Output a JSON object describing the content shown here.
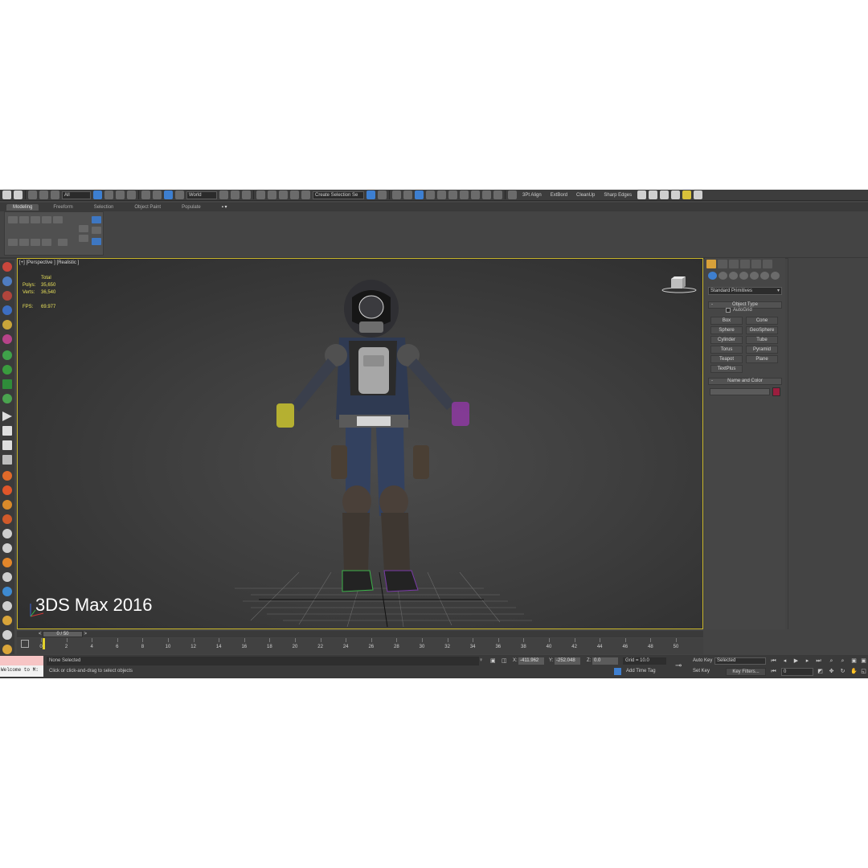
{
  "toolbar": {
    "selection_filter": "All",
    "reference_coord": "World",
    "named_selection": "Create Selection Se",
    "menu_items": [
      "3Pt Align",
      "ExtBord",
      "CleanUp",
      "Sharp Edges"
    ]
  },
  "ribbon": {
    "tabs": [
      "Modeling",
      "Freeform",
      "Selection",
      "Object Paint",
      "Populate"
    ],
    "active_tab": "Modeling"
  },
  "viewport": {
    "label": "[+] [Perspective ] [Realistic ]",
    "stats": {
      "header": "Total",
      "polys_label": "Polys:",
      "polys_value": "35,650",
      "verts_label": "Verts:",
      "verts_value": "36,540",
      "fps_label": "FPS:",
      "fps_value": "69.977"
    },
    "watermark": "3DS Max 2016"
  },
  "command_panel": {
    "category": "Standard Primitives",
    "object_type_header": "Object Type",
    "autogrid_label": "AutoGrid",
    "object_buttons": [
      "Box",
      "Cone",
      "Sphere",
      "GeoSphere",
      "Cylinder",
      "Tube",
      "Torus",
      "Pyramid",
      "Teapot",
      "Plane",
      "TextPlus"
    ],
    "name_color_header": "Name and Color",
    "object_color": "#9b1e3e"
  },
  "timeline": {
    "frame_display": "0 / 50",
    "prev": "<",
    "next": ">",
    "tick_labels": [
      "0",
      "2",
      "4",
      "6",
      "8",
      "10",
      "12",
      "14",
      "16",
      "18",
      "20",
      "22",
      "24",
      "26",
      "28",
      "30",
      "32",
      "34",
      "36",
      "38",
      "40",
      "42",
      "44",
      "46",
      "48",
      "50"
    ]
  },
  "status": {
    "maxscript_text": "Welcome to M:",
    "selection_status": "None Selected",
    "prompt": "Click or click-and-drag to select objects",
    "x_label": "X:",
    "x_value": "-411.962",
    "y_label": "Y:",
    "y_value": "-252.048",
    "z_label": "Z:",
    "z_value": "0.0",
    "grid": "Grid = 10.0",
    "add_time_tag": "Add Time Tag",
    "auto_key": "Auto Key",
    "set_key": "Set Key",
    "key_mode": "Selected",
    "key_filters": "Key Filters...",
    "current_frame": "0"
  }
}
